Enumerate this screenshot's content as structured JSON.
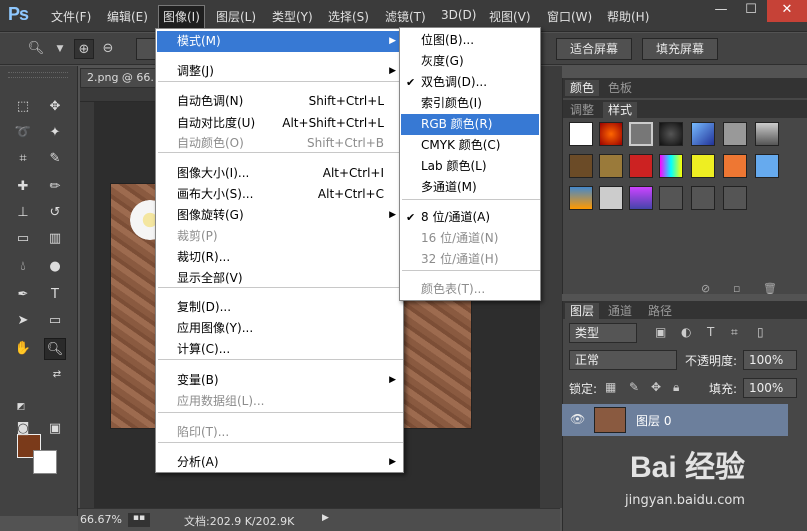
{
  "menubar": {
    "logo": "Ps",
    "items": [
      "文件(F)",
      "编辑(E)",
      "图像(I)",
      "图层(L)",
      "类型(Y)",
      "选择(S)",
      "滤镜(T)",
      "3D(D)",
      "视图(V)",
      "窗口(W)",
      "帮助(H)"
    ],
    "window_controls": [
      "—",
      "☐",
      "✕"
    ]
  },
  "options_bar": {
    "fit_screen_label": "适合屏幕",
    "fill_screen_label": "填充屏幕"
  },
  "document": {
    "tab_title": "2.png @ 66.",
    "zoom": "66.67%",
    "doc_info": "文档:202.9 K/202.9K"
  },
  "image_menu": {
    "items": [
      {
        "label": "模式(M)",
        "shortcut": "",
        "submenu": true,
        "disabled": false
      },
      {
        "label": "调整(J)",
        "shortcut": "",
        "submenu": true,
        "disabled": false
      },
      {
        "label": "自动色调(N)",
        "shortcut": "Shift+Ctrl+L",
        "submenu": false,
        "disabled": false
      },
      {
        "label": "自动对比度(U)",
        "shortcut": "Alt+Shift+Ctrl+L",
        "submenu": false,
        "disabled": false
      },
      {
        "label": "自动颜色(O)",
        "shortcut": "Shift+Ctrl+B",
        "submenu": false,
        "disabled": true
      },
      {
        "label": "图像大小(I)...",
        "shortcut": "Alt+Ctrl+I",
        "submenu": false,
        "disabled": false
      },
      {
        "label": "画布大小(S)...",
        "shortcut": "Alt+Ctrl+C",
        "submenu": false,
        "disabled": false
      },
      {
        "label": "图像旋转(G)",
        "shortcut": "",
        "submenu": true,
        "disabled": false
      },
      {
        "label": "裁剪(P)",
        "shortcut": "",
        "submenu": false,
        "disabled": true
      },
      {
        "label": "裁切(R)...",
        "shortcut": "",
        "submenu": false,
        "disabled": false
      },
      {
        "label": "显示全部(V)",
        "shortcut": "",
        "submenu": false,
        "disabled": false
      },
      {
        "label": "复制(D)...",
        "shortcut": "",
        "submenu": false,
        "disabled": false
      },
      {
        "label": "应用图像(Y)...",
        "shortcut": "",
        "submenu": false,
        "disabled": false
      },
      {
        "label": "计算(C)...",
        "shortcut": "",
        "submenu": false,
        "disabled": false
      },
      {
        "label": "变量(B)",
        "shortcut": "",
        "submenu": true,
        "disabled": false
      },
      {
        "label": "应用数据组(L)...",
        "shortcut": "",
        "submenu": false,
        "disabled": true
      },
      {
        "label": "陷印(T)...",
        "shortcut": "",
        "submenu": false,
        "disabled": true
      },
      {
        "label": "分析(A)",
        "shortcut": "",
        "submenu": true,
        "disabled": false
      }
    ]
  },
  "mode_submenu": {
    "items": [
      {
        "label": "位图(B)...",
        "checked": false,
        "disabled": false
      },
      {
        "label": "灰度(G)",
        "checked": false,
        "disabled": false
      },
      {
        "label": "双色调(D)...",
        "checked": true,
        "disabled": false
      },
      {
        "label": "索引颜色(I)",
        "checked": false,
        "disabled": false
      },
      {
        "label": "RGB 颜色(R)",
        "checked": false,
        "disabled": false
      },
      {
        "label": "CMYK 颜色(C)",
        "checked": false,
        "disabled": false
      },
      {
        "label": "Lab 颜色(L)",
        "checked": false,
        "disabled": false
      },
      {
        "label": "多通道(M)",
        "checked": false,
        "disabled": false
      },
      {
        "label": "8 位/通道(A)",
        "checked": true,
        "disabled": false
      },
      {
        "label": "16 位/通道(N)",
        "checked": false,
        "disabled": true
      },
      {
        "label": "32 位/通道(H)",
        "checked": false,
        "disabled": true
      },
      {
        "label": "颜色表(T)...",
        "checked": false,
        "disabled": true
      }
    ]
  },
  "color_panel": {
    "tabs": [
      "颜色",
      "色板"
    ]
  },
  "style_panel": {
    "tabs": [
      "调整",
      "样式"
    ]
  },
  "layers_panel": {
    "tabs": [
      "图层",
      "通道",
      "路径"
    ],
    "filter_kind": "类型",
    "blend_mode": "正常",
    "opacity_label": "不透明度:",
    "opacity_value": "100%",
    "lock_label": "锁定:",
    "fill_label": "填充:",
    "fill_value": "100%",
    "layer_name": "图层 0"
  },
  "watermark": {
    "brand": "Bai 经验",
    "url": "jingyan.baidu.com"
  },
  "colors": {
    "foreground": "#7a3a1a",
    "background": "#ffffff",
    "highlight": "#3779d4",
    "layer_selected": "#6c7f9c"
  }
}
